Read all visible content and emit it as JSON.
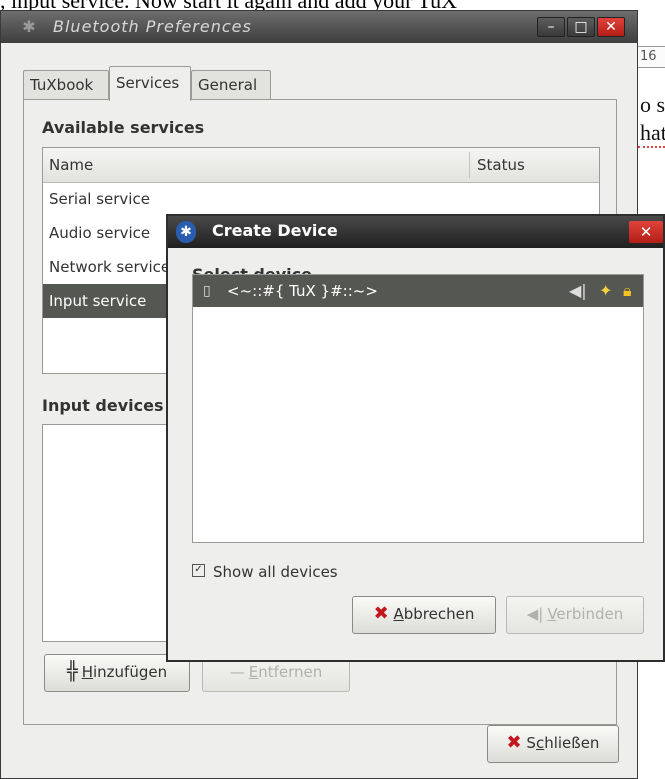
{
  "background_doc": {
    "top_text": ", input service. Now start it again and add your TuX",
    "ruler_text": "16",
    "line1": "o sc",
    "line2": "hat"
  },
  "main_window": {
    "title": "Bluetooth Preferences",
    "tabs": [
      "TuXbook",
      "Services",
      "General"
    ],
    "active_tab": "Services",
    "available_services_title": "Available services",
    "columns": {
      "name": "Name",
      "status": "Status"
    },
    "services": [
      {
        "name": "Serial service",
        "selected": false
      },
      {
        "name": "Audio service",
        "selected": false
      },
      {
        "name": "Network service",
        "selected": false
      },
      {
        "name": "Input service",
        "selected": true
      }
    ],
    "input_devices_title": "Input devices",
    "add_button": "Hinzufügen",
    "add_button_mnemonic": "H",
    "remove_button": "Entfernen",
    "remove_button_mnemonic": "E",
    "close_button": "Schließen",
    "close_button_mnemonic": "c"
  },
  "dialog": {
    "title": "Create Device",
    "select_device_title": "Select device",
    "devices": [
      {
        "name": "<~::#{ TuX }#::~>",
        "icons": [
          "plug-icon",
          "star-icon",
          "lock-icon"
        ]
      }
    ],
    "show_all_label": "Show all devices",
    "show_all_checked": true,
    "cancel_button": "Abbrechen",
    "cancel_mnemonic": "A",
    "connect_button": "Verbinden",
    "connect_mnemonic": "V"
  },
  "colors": {
    "selection": "#555753",
    "close_red": "#c4161c",
    "window_bg": "#eeeeec"
  }
}
